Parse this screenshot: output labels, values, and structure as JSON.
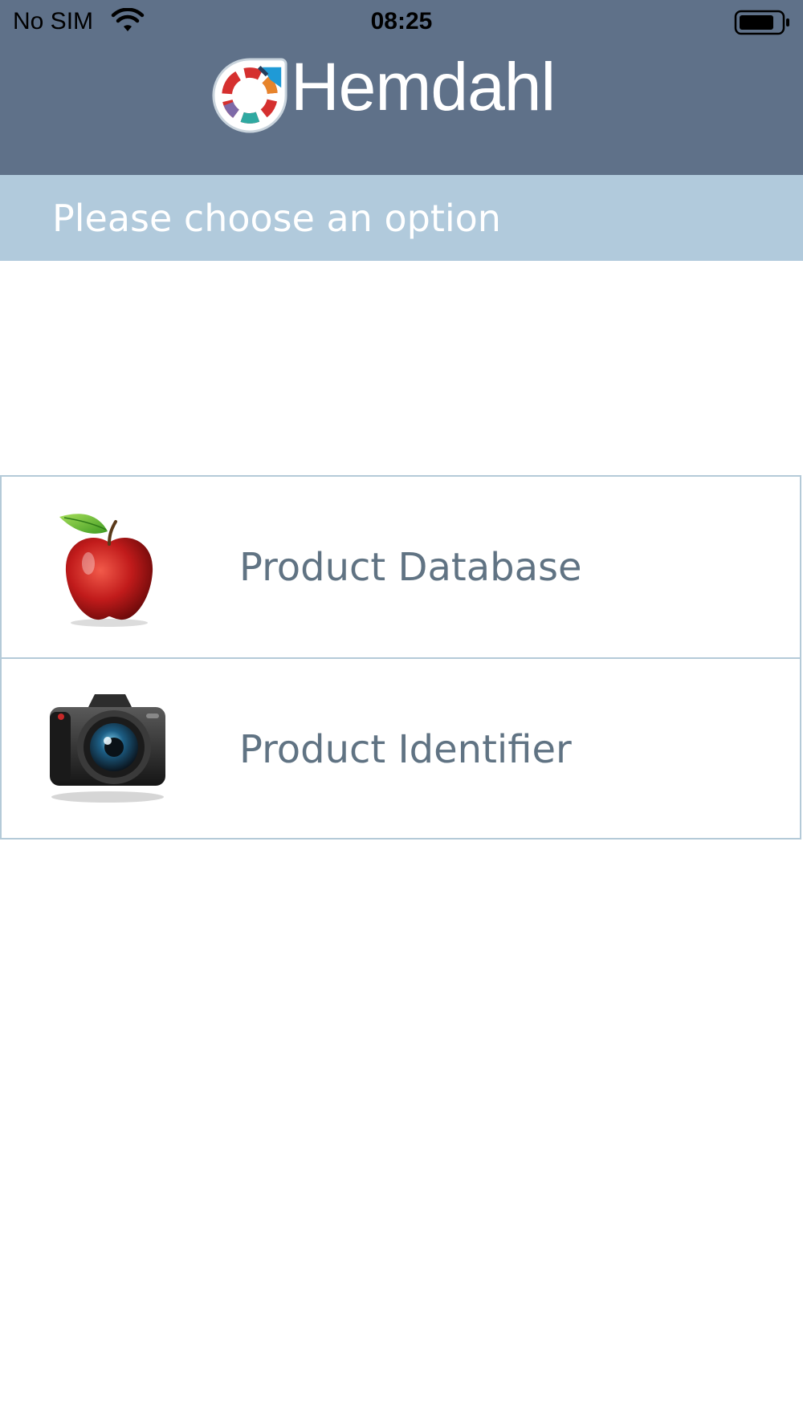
{
  "status_bar": {
    "carrier": "No SIM",
    "wifi_icon": "wifi-icon",
    "time": "08:25",
    "battery_icon": "battery-icon"
  },
  "header": {
    "brand": "Hemdahl",
    "logo_icon": "hemdahl-logo-mark",
    "background": "#5f7189"
  },
  "prompt": {
    "text": "Please choose an option",
    "background": "#b1cadc"
  },
  "menu": {
    "items": [
      {
        "label": "Product Database",
        "icon": "apple-icon"
      },
      {
        "label": "Product Identifier",
        "icon": "camera-icon"
      }
    ],
    "label_color": "#607383",
    "border_color": "#b4cad8"
  }
}
